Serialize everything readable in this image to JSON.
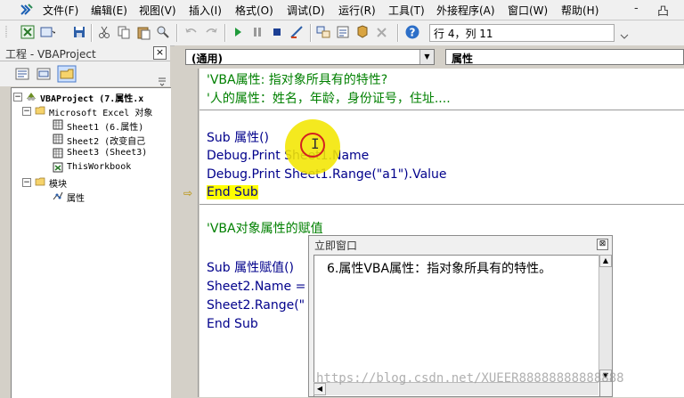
{
  "menu": {
    "items": [
      "文件(F)",
      "编辑(E)",
      "视图(V)",
      "插入(I)",
      "格式(O)",
      "调试(D)",
      "运行(R)",
      "工具(T)",
      "外接程序(A)",
      "窗口(W)",
      "帮助(H)"
    ],
    "window_controls": [
      "-",
      "凸"
    ]
  },
  "toolbar": {
    "position_label": "行 4，列 11"
  },
  "project_panel": {
    "title": "工程 - VBAProject",
    "close_glyph": "×",
    "tree": [
      {
        "label": "VBAProject (7.属性.x",
        "depth": 0
      },
      {
        "label": "Microsoft Excel 对象",
        "depth": 1
      },
      {
        "label": "Sheet1 (6.属性)",
        "depth": 2
      },
      {
        "label": "Sheet2 (改变自己",
        "depth": 2
      },
      {
        "label": "Sheet3 (Sheet3)",
        "depth": 2
      },
      {
        "label": "ThisWorkbook",
        "depth": 2
      },
      {
        "label": "模块",
        "depth": 1
      },
      {
        "label": "属性",
        "depth": 2
      }
    ]
  },
  "code_window": {
    "object_combo": "(通用)",
    "proc_combo": "属性",
    "lines": [
      "'VBA属性: 指对象所具有的特性?",
      "'人的属性：姓名，年龄，身份证号，住址....",
      "Sub 属性()",
      " Debug.Print Sheet1.Name",
      " Debug.Print Sheet1.Range(\"a1\").Value",
      "End Sub",
      "'VBA对象属性的赋值",
      "Sub 属性赋值()",
      "Sheet2.Name =",
      "Sheet2.Range(\"",
      "End Sub"
    ]
  },
  "immediate_window": {
    "title": "立即窗口",
    "output": "6.属性VBA属性：指对象所具有的特性。"
  },
  "watermark": "https://blog.csdn.net/XUEER88888888888888",
  "colors": {
    "comment": "#008000",
    "keyword": "#00008b",
    "highlight": "#ffff00"
  }
}
